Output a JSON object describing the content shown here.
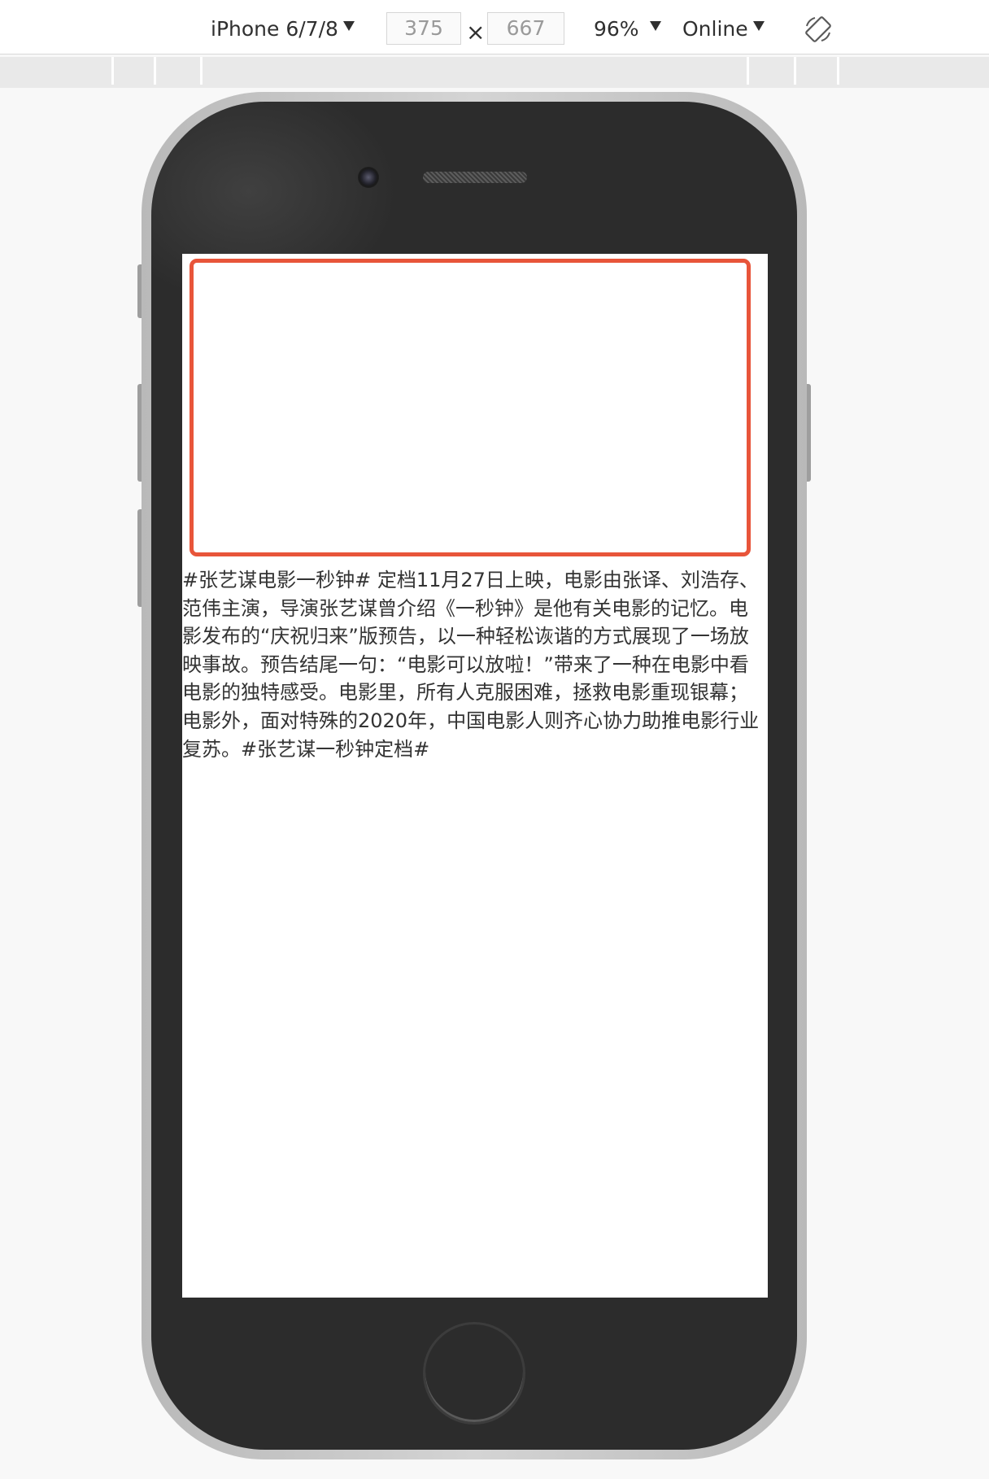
{
  "toolbar": {
    "device": "iPhone 6/7/8",
    "width_value": "375",
    "times_symbol": "×",
    "height_value": "667",
    "zoom": "96%",
    "network": "Online",
    "rotate_icon": "rotate-icon"
  },
  "screen": {
    "video_placeholder_border_color": "#e8553a",
    "article_text": "#张艺谋电影一秒钟# 定档11月27日上映，电影由张译、刘浩存、范伟主演，导演张艺谋曾介绍《一秒钟》是他有关电影的记忆。电影发布的“庆祝归来”版预告，以一种轻松诙谐的方式展现了一场放映事故。预告结尾一句：“电影可以放啦！”带来了一种在电影中看电影的独特感受。电影里，所有人克服困难，拯救电影重现银幕；电影外，面对特殊的2020年，中国电影人则齐心协力助推电影行业复苏。#张艺谋一秒钟定档#"
  },
  "colors": {
    "phone_body": "#2c2c2c",
    "phone_rim": "#c4c4c4",
    "toolbar_bg": "#ffffff",
    "ruler_bg": "#e9e9e9",
    "page_bg": "#f8f8f8"
  }
}
